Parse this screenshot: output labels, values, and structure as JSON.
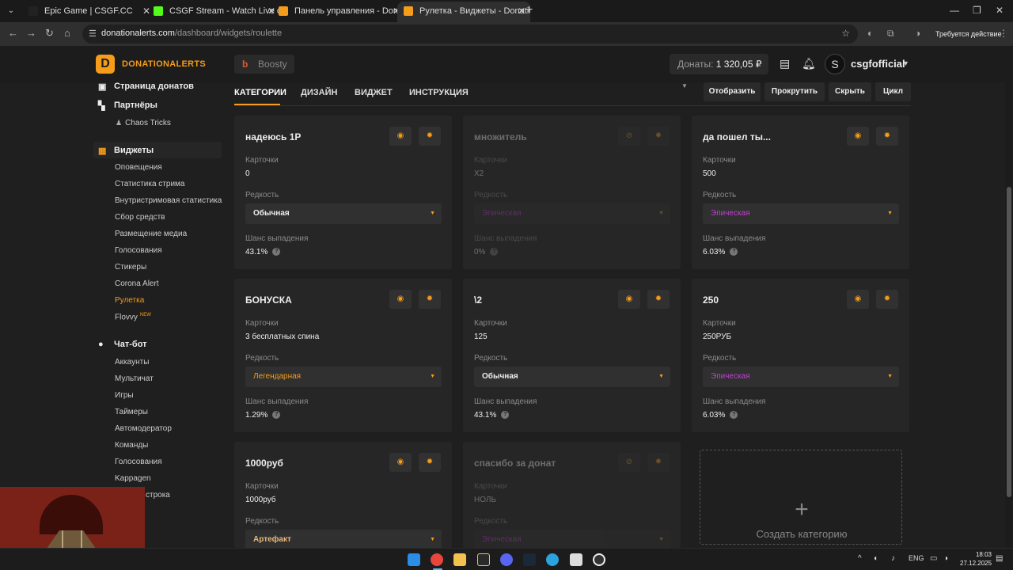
{
  "browser": {
    "tabs": [
      {
        "title": "Epic Game | CSGF.CC",
        "fav_color": "#222222"
      },
      {
        "title": "CSGF Stream - Watch Live on K",
        "fav_color": "#53fc18"
      },
      {
        "title": "Панель управления - Donation",
        "fav_color": "#f59c1a"
      },
      {
        "title": "Рулетка - Виджеты - Donation",
        "fav_color": "#f59c1a"
      }
    ],
    "url_domain": "donationalerts.com",
    "url_path": "/dashboard/widgets/roulette",
    "action_required": "Требуется действие"
  },
  "header": {
    "logo_text": "DONATIONALERTS",
    "boosty_label": "Boosty",
    "donats_label": "Донаты:",
    "donats_value": "1 320,05 ₽",
    "username": "csgfofficial"
  },
  "sidebar": {
    "sections": [
      {
        "label": "Страница донатов",
        "icon": "page-icon"
      },
      {
        "label": "Партнёры",
        "icon": "partners-icon"
      },
      {
        "label": "Виджеты",
        "icon": "widgets-icon"
      },
      {
        "label": "Чат-бот",
        "icon": "chat-icon"
      }
    ],
    "partners_items": [
      "Chaos Tricks"
    ],
    "widget_items": [
      "Оповещения",
      "Статистика стрима",
      "Внутристримовая статистика",
      "Сбор средств",
      "Размещение медиа",
      "Голосования",
      "Стикеры",
      "Corona Alert",
      "Рулетка",
      "Flovvy"
    ],
    "flovvy_badge": "NEW",
    "chatbot_items": [
      "Аккаунты",
      "Мультичат",
      "Игры",
      "Таймеры",
      "Автомодератор",
      "Команды",
      "Голосования",
      "Kappagen",
      "строка"
    ]
  },
  "tabs": [
    "КАТЕГОРИИ",
    "ДИЗАЙН",
    "ВИДЖЕТ",
    "ИНСТРУКЦИЯ"
  ],
  "toolbar": [
    "Отобразить",
    "Прокрутить",
    "Скрыть",
    "Цикл"
  ],
  "labels": {
    "cards": "Карточки",
    "rarity": "Редкость",
    "chance": "Шанс выпадения",
    "create": "Создать категорию"
  },
  "cards": [
    {
      "title": "надеюсь 1Р",
      "cards": "0",
      "rarity": "Обычная",
      "chance": "43.1%"
    },
    {
      "title": "множитель",
      "cards": "X2",
      "rarity": "Эпическая",
      "chance": "0%"
    },
    {
      "title": "да пошел ты...",
      "cards": "500",
      "rarity": "Эпическая",
      "chance": "6.03%"
    },
    {
      "title": "БОНУСКА",
      "cards": "3 бесплатных спина",
      "rarity": "Легендарная",
      "chance": "1.29%"
    },
    {
      "title": "\\2",
      "cards": "125",
      "rarity": "Обычная",
      "chance": "43.1%"
    },
    {
      "title": "250",
      "cards": "250РУБ",
      "rarity": "Эпическая",
      "chance": "6.03%"
    },
    {
      "title": "1000руб",
      "cards": "1000руб",
      "rarity": "Артефакт"
    },
    {
      "title": "спасибо за донат",
      "cards": "НОЛЬ",
      "rarity": "Эпическая"
    }
  ],
  "taskbar": {
    "lang": "ENG",
    "time": "18:03",
    "date": "27.12.2025"
  }
}
